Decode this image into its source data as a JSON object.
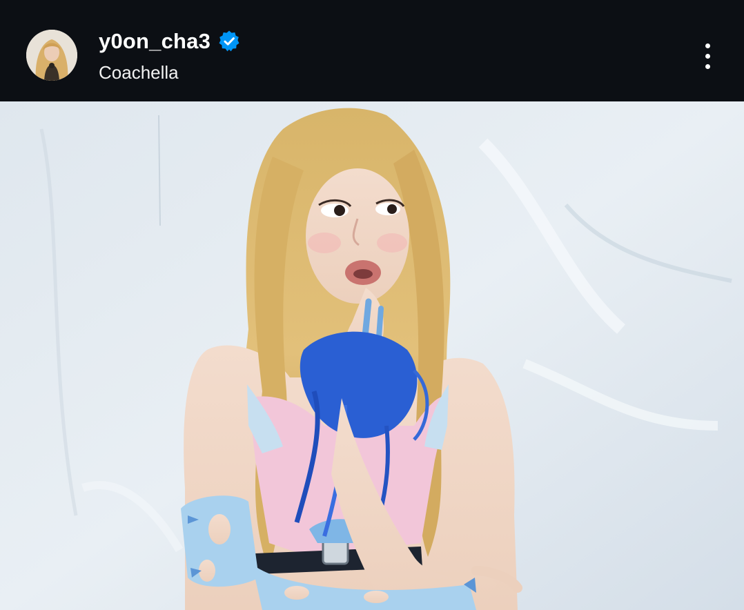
{
  "post_header": {
    "username": "y0on_cha3",
    "verified": true,
    "verified_icon": "verified-badge-icon",
    "location": "Coachella",
    "more_icon": "more-vertical-icon",
    "avatar_icon": "profile-avatar"
  },
  "colors": {
    "header_background": "#0c0f14",
    "verified_blue": "#0095f6",
    "text": "#ffffff"
  }
}
